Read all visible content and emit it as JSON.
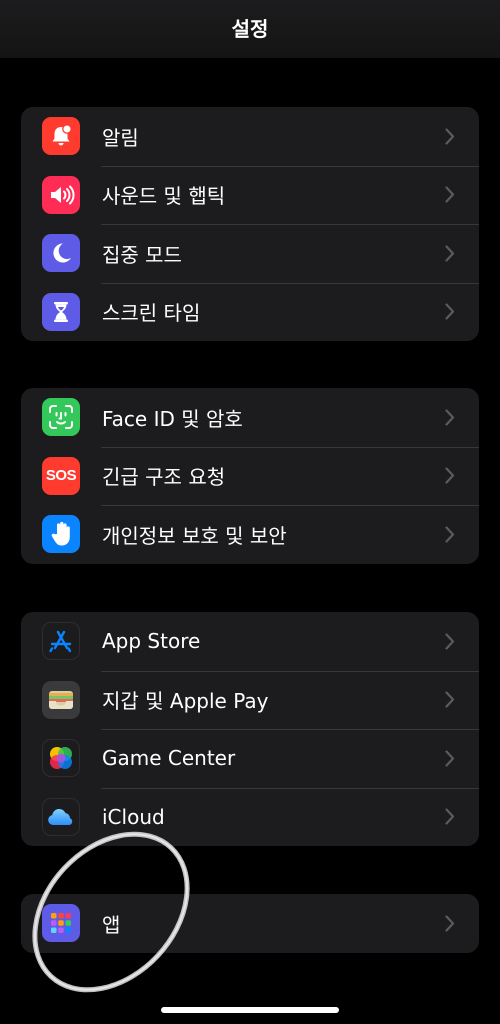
{
  "header": {
    "title": "설정"
  },
  "groups": [
    {
      "items": [
        {
          "label": "알림",
          "icon": "bell-badge-icon",
          "color": "#ff3b30"
        },
        {
          "label": "사운드 및 햅틱",
          "icon": "speaker-wave-icon",
          "color": "#ff2d55"
        },
        {
          "label": "집중 모드",
          "icon": "moon-icon",
          "color": "#5e5ce6"
        },
        {
          "label": "스크린 타임",
          "icon": "hourglass-icon",
          "color": "#5e5ce6"
        }
      ]
    },
    {
      "items": [
        {
          "label": "Face ID 및 암호",
          "icon": "face-id-icon",
          "color": "#34c759"
        },
        {
          "label": "긴급 구조 요청",
          "icon": "sos-icon",
          "color": "#ff3b30",
          "icon_text": "SOS"
        },
        {
          "label": "개인정보 보호 및 보안",
          "icon": "hand-raised-icon",
          "color": "#0a84ff"
        }
      ]
    },
    {
      "items": [
        {
          "label": "App Store",
          "icon": "app-store-icon",
          "color": "#1c1c1e"
        },
        {
          "label": "지갑 및 Apple Pay",
          "icon": "wallet-icon",
          "color": "#2c2c2e"
        },
        {
          "label": "Game Center",
          "icon": "game-center-icon",
          "color": "#1c1c1e"
        },
        {
          "label": "iCloud",
          "icon": "icloud-icon",
          "color": "#1c1c1e"
        }
      ]
    },
    {
      "items": [
        {
          "label": "앱",
          "icon": "apps-grid-icon",
          "color": "#5e5ce6"
        }
      ]
    }
  ]
}
